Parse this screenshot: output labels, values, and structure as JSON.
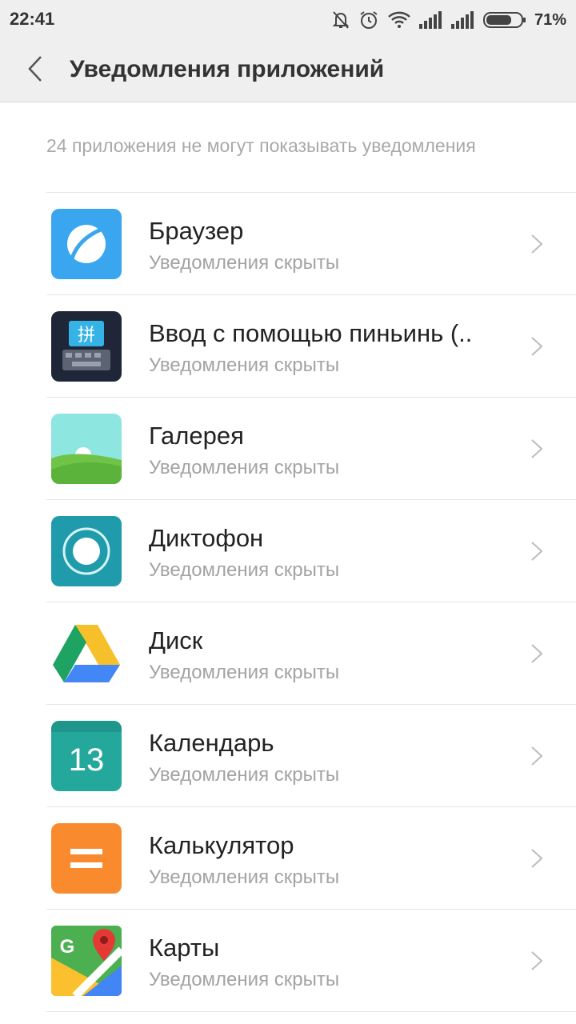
{
  "status_bar": {
    "time": "22:41",
    "icons": [
      "muted-bell-icon",
      "alarm-icon",
      "wifi-icon",
      "signal-icon",
      "signal-icon",
      "battery-icon"
    ],
    "battery": "71%"
  },
  "header": {
    "title": "Уведомления приложений",
    "back_icon": "chevron-left-icon"
  },
  "info_text": "24 приложения не могут показывать уведомления",
  "apps": [
    {
      "name": "Браузер",
      "status": "Уведомления скрыты",
      "icon": "browser-icon"
    },
    {
      "name": "Ввод с помощью пиньинь (..",
      "status": "Уведомления скрыты",
      "icon": "pinyin-keyboard-icon"
    },
    {
      "name": "Галерея",
      "status": "Уведомления скрыты",
      "icon": "gallery-icon"
    },
    {
      "name": "Диктофон",
      "status": "Уведомления скрыты",
      "icon": "recorder-icon"
    },
    {
      "name": "Диск",
      "status": "Уведомления скрыты",
      "icon": "drive-icon"
    },
    {
      "name": "Календарь",
      "status": "Уведомления скрыты",
      "icon": "calendar-icon",
      "icon_text": "13"
    },
    {
      "name": "Калькулятор",
      "status": "Уведомления скрыты",
      "icon": "calculator-icon"
    },
    {
      "name": "Карты",
      "status": "Уведомления скрыты",
      "icon": "maps-icon",
      "icon_text": "G"
    }
  ],
  "colors": {
    "header_bg": "#efefef",
    "secondary_text": "#a3a3a3",
    "divider": "#e6e6e6"
  }
}
